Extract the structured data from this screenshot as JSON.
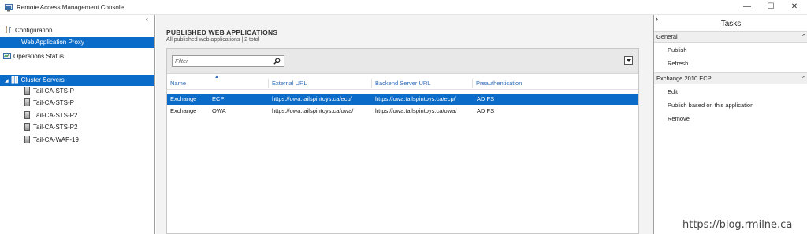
{
  "window": {
    "title": "Remote Access Management Console",
    "minimize": "—",
    "maximize": "☐",
    "close": "✕"
  },
  "tree": {
    "collapse_glyph": "‹",
    "configuration": "Configuration",
    "web_application_proxy": "Web Application Proxy",
    "operations_status": "Operations Status",
    "cluster_servers": "Cluster Servers",
    "servers": [
      "Tail-CA-STS-P",
      "Tail-CA-STS-P",
      "Tail-CA-STS-P2",
      "Tail-CA-STS-P2",
      "Tail-CA-WAP-19"
    ]
  },
  "main": {
    "title": "PUBLISHED WEB APPLICATIONS",
    "subtitle": "All published web applications | 2 total",
    "filter_placeholder": "Filter",
    "columns": {
      "name": "Name",
      "external_url": "External URL",
      "backend_url": "Backend Server URL",
      "preauth": "Preauthentication"
    },
    "rows": [
      {
        "name": "Exchange",
        "app": "ECP",
        "external_url": "https://owa.tailspintoys.ca/ecp/",
        "backend_url": "https://owa.tailspintoys.ca/ecp/",
        "preauth": "AD FS",
        "selected": true
      },
      {
        "name": "Exchange",
        "app": "OWA",
        "external_url": "https://owa.tailspintoys.ca/owa/",
        "backend_url": "https://owa.tailspintoys.ca/owa/",
        "preauth": "AD FS",
        "selected": false
      }
    ]
  },
  "tasks": {
    "expand_glyph": "›",
    "title": "Tasks",
    "general": {
      "label": "General",
      "items": [
        "Publish",
        "Refresh"
      ]
    },
    "selection": {
      "label": "Exchange 2010 ECP",
      "items": [
        "Edit",
        "Publish based on this application",
        "Remove"
      ]
    },
    "chevron": "^"
  },
  "watermark": "https://blog.rmilne.ca",
  "colors": {
    "selection": "#0a6bc8",
    "column_header": "#2c6bb8"
  }
}
